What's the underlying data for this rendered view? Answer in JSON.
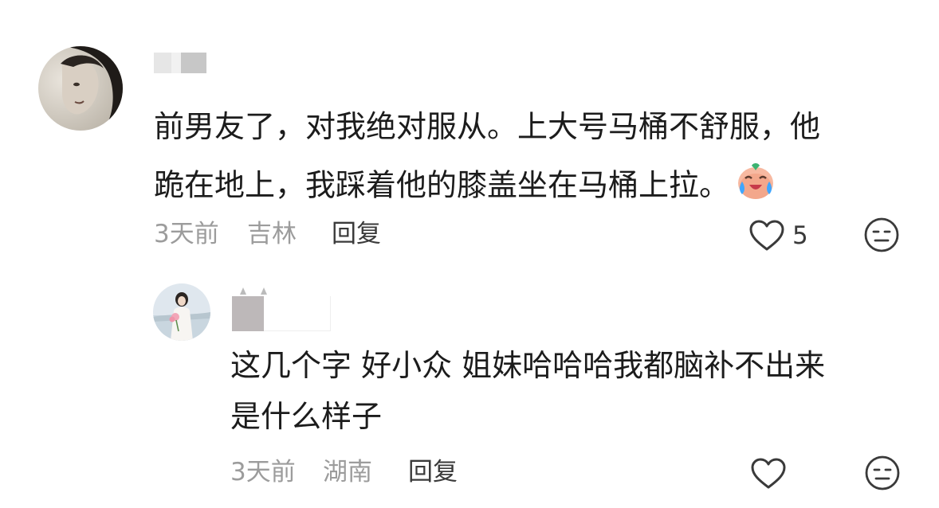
{
  "comment": {
    "line1": "前男友了，对我绝对服从。上大号马桶不舒服，他",
    "line2": "跪在地上，我踩着他的膝盖坐在马桶上拉。",
    "time": "3天前",
    "location": "吉林",
    "reply_label": "回复",
    "like_count": "5",
    "emoji_icon": "laugh-cry-emoji-icon",
    "like_icon": "heart-outline-icon",
    "dislike_icon": "meh-face-icon"
  },
  "reply": {
    "line1": "这几个字 好小众 姐妹哈哈哈我都脑补不出来",
    "line2": "是什么样子",
    "time": "3天前",
    "location": "湖南",
    "reply_label": "回复",
    "like_icon": "heart-outline-icon",
    "dislike_icon": "meh-face-icon"
  }
}
